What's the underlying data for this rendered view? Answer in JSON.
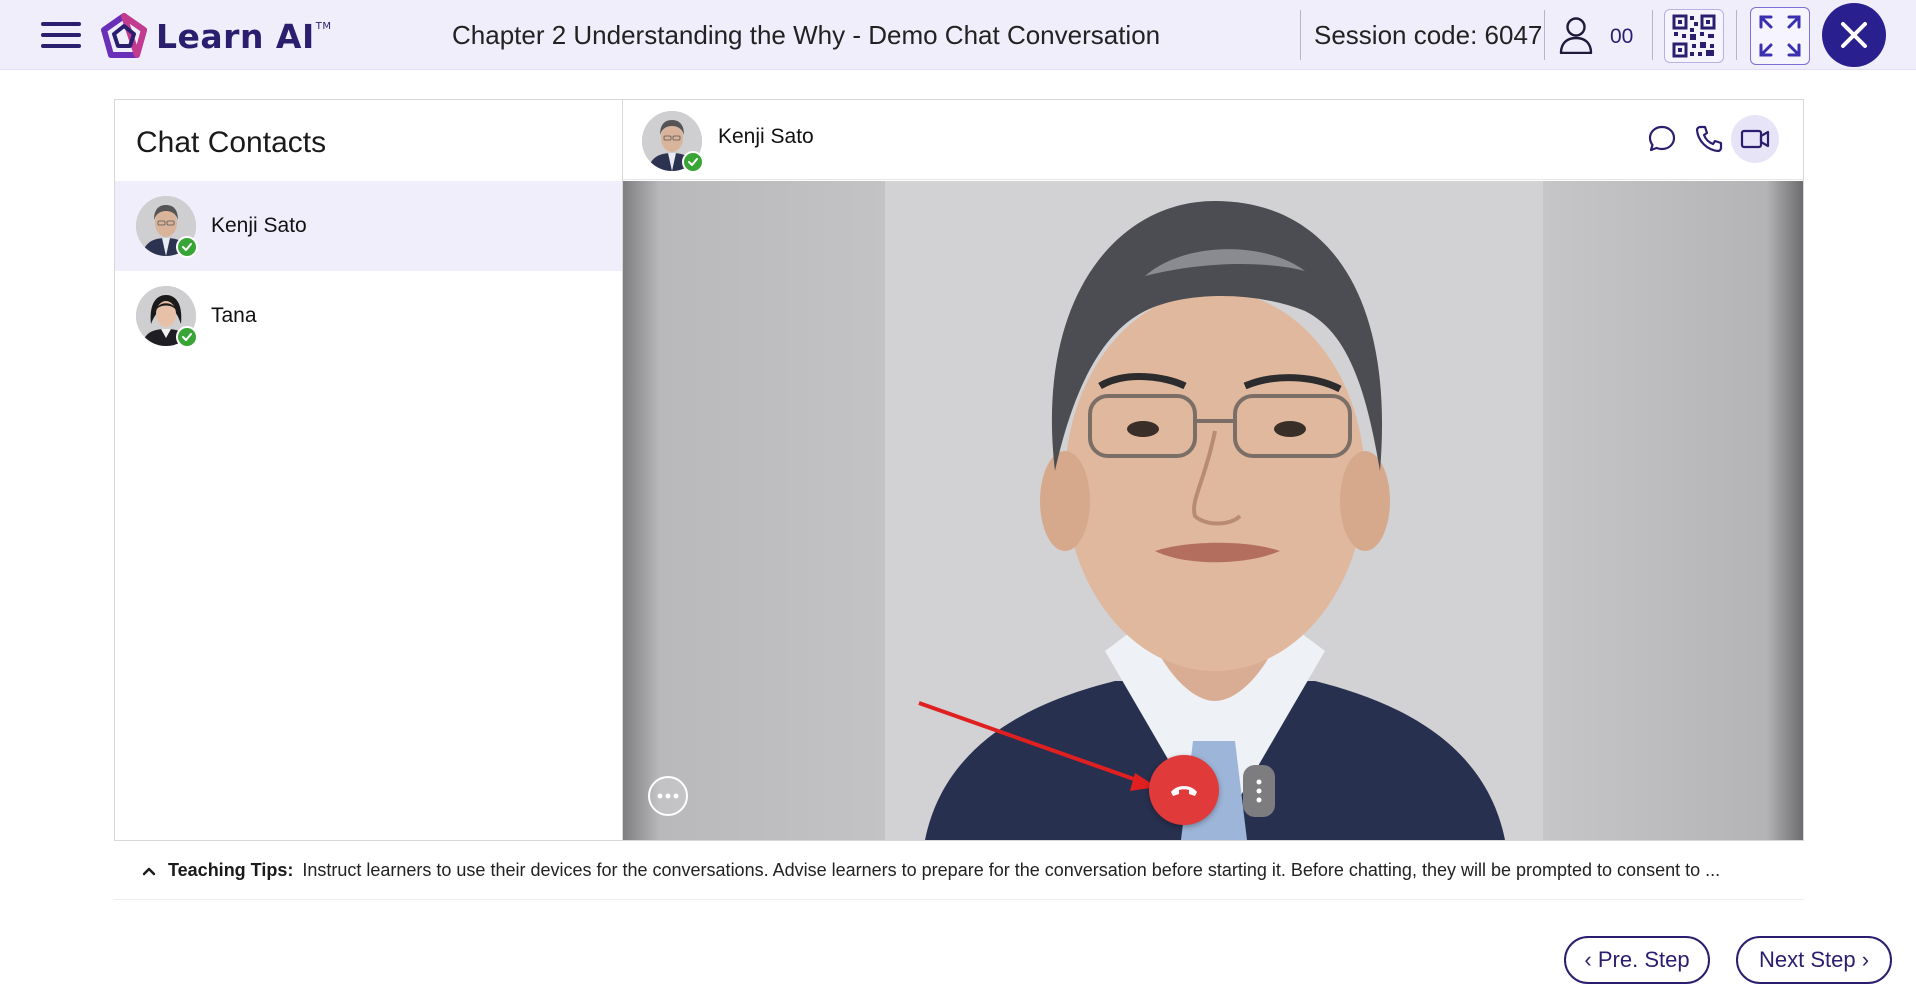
{
  "app": {
    "logo_text": "Learn AI",
    "logo_trademark": "TM",
    "title": "Chapter 2 Understanding the Why - Demo Chat Conversation",
    "session_code": "Session code: 6047",
    "user_count": "00",
    "accent_color": "#2a1f6e"
  },
  "contacts": {
    "title": "Chat Contacts",
    "items": [
      {
        "name": "Kenji Sato",
        "status": "online",
        "active": true
      },
      {
        "name": "Tana",
        "status": "online",
        "active": false
      }
    ]
  },
  "chat": {
    "contact_name": "Kenji Sato",
    "header_icons": [
      "chat-bubble-icon",
      "phone-icon",
      "video-camera-icon"
    ],
    "selected_mode": "video",
    "video_controls": [
      "more-options-icon",
      "end-call-icon",
      "vertical-dots-icon"
    ],
    "end_call_color": "#e03a3a"
  },
  "tips": {
    "label": "Teaching Tips:",
    "text": "Instruct learners to use their devices for the conversations. Advise learners to prepare for the conversation before starting it. Before chatting, they will be prompted to consent to ..."
  },
  "footer": {
    "prev_label": "Pre. Step",
    "next_label": "Next Step"
  }
}
